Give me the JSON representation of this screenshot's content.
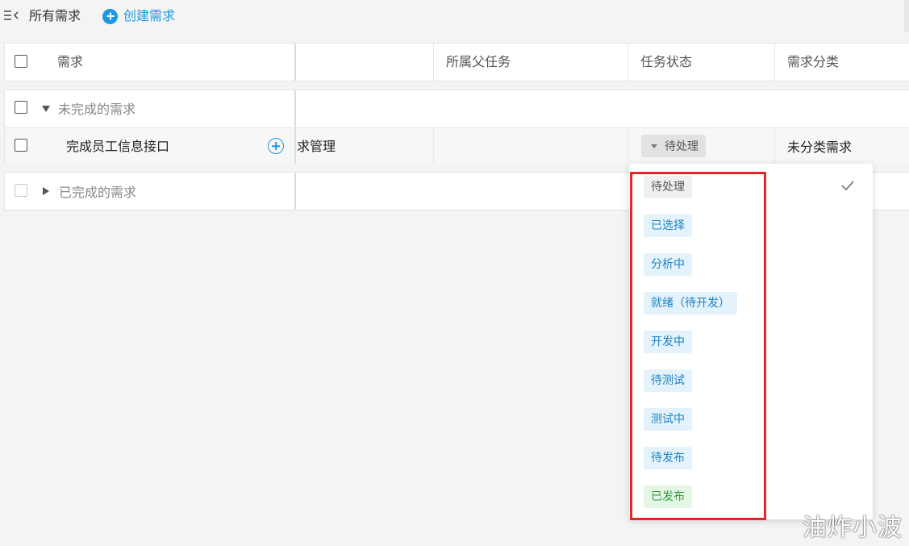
{
  "toolbar": {
    "title": "所有需求",
    "create_label": "创建需求"
  },
  "table": {
    "columns": {
      "requirement": "需求",
      "parent_task": "所属父任务",
      "task_status": "任务状态",
      "category": "需求分类"
    }
  },
  "groups": {
    "incomplete": {
      "label": "未完成的需求"
    },
    "complete": {
      "label": "已完成的需求"
    }
  },
  "task": {
    "title": "完成员工信息接口",
    "project_fragment": "求管理",
    "status": "待处理",
    "category": "未分类需求"
  },
  "status_options": [
    {
      "label": "待处理",
      "bg": "#efefef",
      "fg": "#555555",
      "selected": true
    },
    {
      "label": "已选择",
      "bg": "#e3f2fb",
      "fg": "#1c84c6",
      "selected": false
    },
    {
      "label": "分析中",
      "bg": "#e3f2fb",
      "fg": "#1c84c6",
      "selected": false
    },
    {
      "label": "就绪（待开发）",
      "bg": "#e3f2fb",
      "fg": "#1c84c6",
      "selected": false
    },
    {
      "label": "开发中",
      "bg": "#e3f2fb",
      "fg": "#1c84c6",
      "selected": false
    },
    {
      "label": "待测试",
      "bg": "#e3f2fb",
      "fg": "#1c84c6",
      "selected": false
    },
    {
      "label": "测试中",
      "bg": "#e3f2fb",
      "fg": "#1c84c6",
      "selected": false
    },
    {
      "label": "待发布",
      "bg": "#e3f2fb",
      "fg": "#1c84c6",
      "selected": false
    },
    {
      "label": "已发布",
      "bg": "#e4f6e4",
      "fg": "#2e9a3e",
      "selected": false
    }
  ],
  "watermark": "油炸小波"
}
